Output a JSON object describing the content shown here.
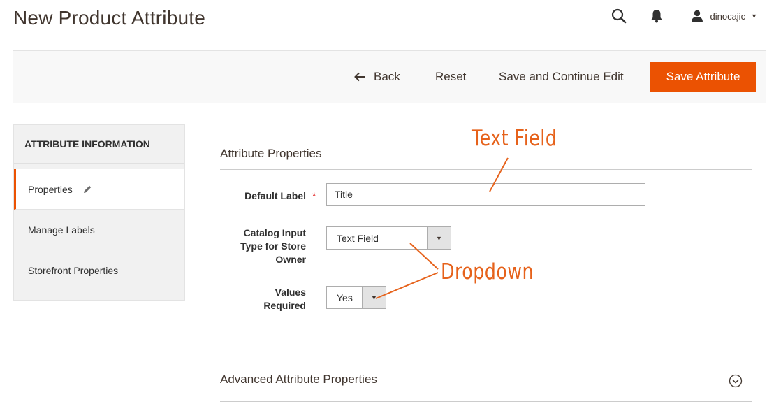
{
  "page": {
    "title": "New Product Attribute"
  },
  "header": {
    "username": "dinocajic",
    "icons": [
      "search-icon",
      "bell-icon",
      "user-icon",
      "caret-down-icon"
    ]
  },
  "actions": {
    "back_label": "Back",
    "reset_label": "Reset",
    "save_continue_label": "Save and Continue Edit",
    "save_label": "Save Attribute"
  },
  "sidebar": {
    "title": "ATTRIBUTE INFORMATION",
    "items": [
      {
        "label": "Properties",
        "active": true
      },
      {
        "label": "Manage Labels",
        "active": false
      },
      {
        "label": "Storefront Properties",
        "active": false
      }
    ]
  },
  "form": {
    "section_title": "Attribute Properties",
    "default_label": {
      "label": "Default Label",
      "required_mark": "*",
      "value": "Title"
    },
    "input_type": {
      "label": "Catalog Input Type for Store Owner",
      "selected": "Text Field"
    },
    "values_required": {
      "label": "Values Required",
      "selected": "Yes"
    },
    "advanced_title": "Advanced Attribute Properties"
  },
  "annotations": {
    "text_field": "Text Field",
    "dropdown": "Dropdown"
  },
  "colors": {
    "accent": "#eb5202",
    "annotation": "#e6621b",
    "title": "#41362f"
  }
}
